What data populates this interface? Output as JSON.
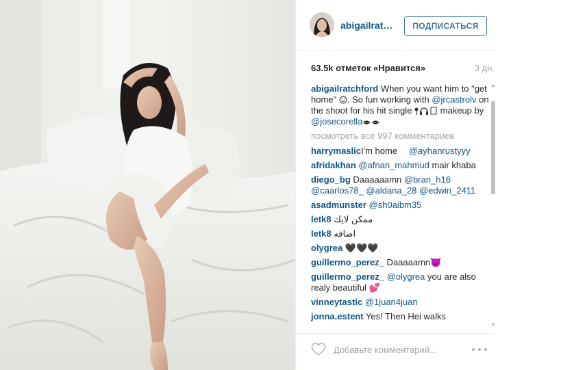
{
  "post": {
    "username": "abigailratchford",
    "username_short": "abigailratc...",
    "follow_label": "ПОДПИСАТЬСЯ",
    "likes": "63.5k отметок «Нравится»",
    "time": "3 дн."
  },
  "caption": {
    "author": "abigailratchford",
    "text_1": " When you want him to \"get home\" ",
    "text_2": ". So fun working with ",
    "mention_1": "@jrcastrolv",
    "text_3": " on the shoot for his hit single ",
    "text_4": " makeup by ",
    "mention_2": "@josecorella"
  },
  "view_all": "посмотреть все 997 комментариев",
  "comments": [
    {
      "user": "harrymaslic",
      "text": "I'm home ⠀ ",
      "mention": "@ayhanrustyyy",
      "extra": ""
    },
    {
      "user": "afridakhan",
      "text": " ",
      "mention": "@afnan_mahmud",
      "extra": " mair khaba"
    },
    {
      "user": "diego_bg",
      "text": " Daaaaaamn ",
      "mention": "@bran_h16 @caarlos78_ @aldana_28 @edwin_2411",
      "extra": ""
    },
    {
      "user": "asadmunster",
      "text": " ",
      "mention": "@sh0aibm35",
      "extra": ""
    },
    {
      "user": "letk8",
      "text": " ممكن لايك",
      "mention": "",
      "extra": ""
    },
    {
      "user": "letk8",
      "text": " اضافه",
      "mention": "",
      "extra": ""
    },
    {
      "user": "olygrea",
      "text": " 🖤🖤🖤",
      "mention": "",
      "extra": ""
    },
    {
      "user": "guillermo_perez_",
      "text": " Daaaaamn😈",
      "mention": "",
      "extra": ""
    },
    {
      "user": "guillermo_perez_",
      "text": " ",
      "mention": "@olygrea",
      "extra": " you are also realy beautiful 💕"
    },
    {
      "user": "vinneytastic",
      "text": " ",
      "mention": "@1juan4juan",
      "extra": ""
    },
    {
      "user": "jonna.estent",
      "text": " Yes! Then Hei walks",
      "mention": "",
      "extra": ""
    }
  ],
  "footer": {
    "add_comment_placeholder": "Добавьте комментарий..."
  },
  "icons": {
    "heart": "heart-outline-icon",
    "more": "more-options-icon"
  },
  "colors": {
    "link": "#125688",
    "follow_border": "#3f729b",
    "muted": "#a5a7aa"
  }
}
